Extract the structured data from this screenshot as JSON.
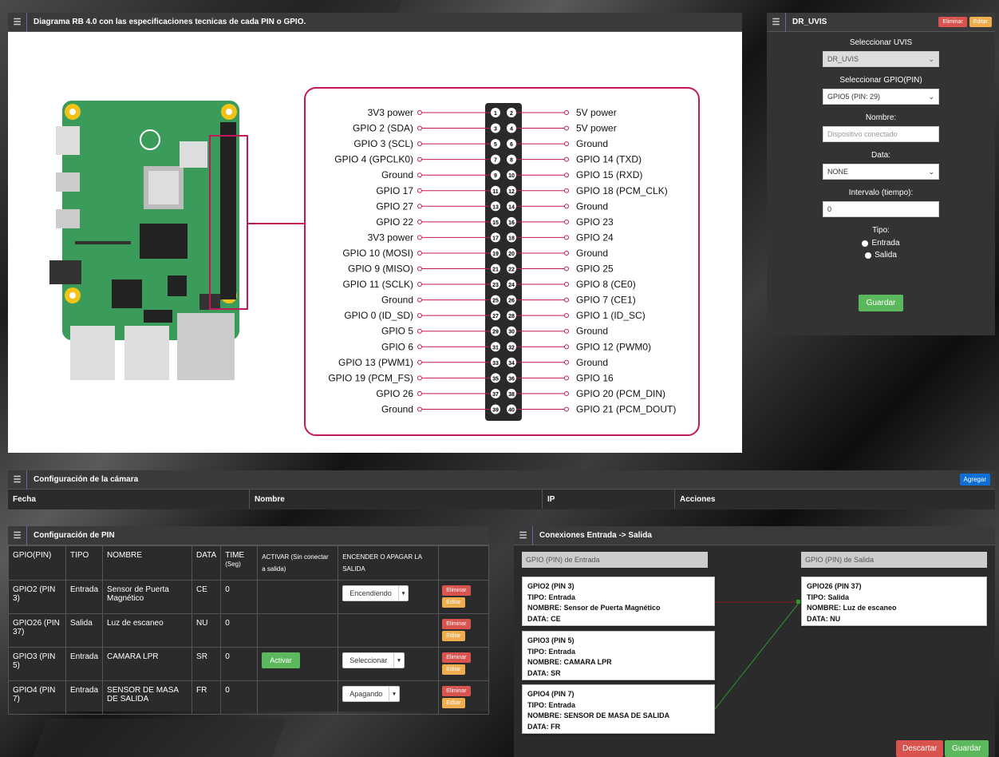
{
  "diagram": {
    "title": "Diagrama RB 4.0 con las especificaciones tecnicas de cada PIN o GPIO.",
    "pins_left": [
      "3V3 power",
      "GPIO 2 (SDA)",
      "GPIO 3 (SCL)",
      "GPIO 4 (GPCLK0)",
      "Ground",
      "GPIO 17",
      "GPIO 27",
      "GPIO 22",
      "3V3 power",
      "GPIO 10 (MOSI)",
      "GPIO 9 (MISO)",
      "GPIO 11 (SCLK)",
      "Ground",
      "GPIO 0 (ID_SD)",
      "GPIO 5",
      "GPIO 6",
      "GPIO 13 (PWM1)",
      "GPIO 19 (PCM_FS)",
      "GPIO 26",
      "Ground"
    ],
    "pins_right": [
      "5V power",
      "5V power",
      "Ground",
      "GPIO 14 (TXD)",
      "GPIO 15 (RXD)",
      "GPIO 18 (PCM_CLK)",
      "Ground",
      "GPIO 23",
      "GPIO 24",
      "Ground",
      "GPIO 25",
      "GPIO 8 (CE0)",
      "GPIO 7 (CE1)",
      "GPIO 1 (ID_SC)",
      "Ground",
      "GPIO 12 (PWM0)",
      "Ground",
      "GPIO 16",
      "GPIO 20 (PCM_DIN)",
      "GPIO 21 (PCM_DOUT)"
    ],
    "accent": "#c2185b"
  },
  "uvis": {
    "title": "DR_UVIS",
    "delete": "Eliminar",
    "edit": "Editar",
    "sel_uvis_label": "Seleccionar UVIS",
    "sel_uvis_value": "DR_UVIS",
    "sel_gpio_label": "Seleccionar GPIO(PIN)",
    "sel_gpio_value": "GPIO5 (PIN: 29)",
    "name_label": "Nombre:",
    "name_placeholder": "Dispositivo conectado",
    "data_label": "Data:",
    "data_value": "NONE",
    "interval_label": "Intervalo (tiempo):",
    "interval_value": "0",
    "type_label": "Tipo:",
    "type_in": "Entrada",
    "type_out": "Salida",
    "save": "Guardar"
  },
  "camera": {
    "title": "Configuración de la cámara",
    "add": "Agregar",
    "cols": [
      "Fecha",
      "Nombre",
      "IP",
      "Acciones"
    ]
  },
  "pins": {
    "title": "Configuración de PIN",
    "cols": [
      "GPIO(PIN)",
      "TIPO",
      "NOMBRE",
      "DATA",
      "TIME",
      "(Seg)",
      "ACTIVAR (Sin conectar",
      "a salida)",
      "ENCENDER O APAGAR LA",
      "SALIDA"
    ],
    "rows": [
      {
        "gpio": "GPIO2 (PIN 3)",
        "tipo": "Entrada",
        "nombre": "Sensor de Puerta Magnético",
        "data": "CE",
        "time": "0",
        "activar": "",
        "dd": "Encendiendo"
      },
      {
        "gpio": "GPIO26 (PIN 37)",
        "tipo": "Salida",
        "nombre": "Luz de escaneo",
        "data": "NU",
        "time": "0",
        "activar": "",
        "dd": ""
      },
      {
        "gpio": "GPIO3 (PIN 5)",
        "tipo": "Entrada",
        "nombre": "CAMARA LPR",
        "data": "SR",
        "time": "0",
        "activar": "Activar",
        "dd": "Seleccionar"
      },
      {
        "gpio": "GPIO4 (PIN 7)",
        "tipo": "Entrada",
        "nombre": "SENSOR DE MASA DE SALIDA",
        "data": "FR",
        "time": "0",
        "activar": "",
        "dd": "Apagando"
      }
    ],
    "delete": "Eliminar",
    "edit": "Editar"
  },
  "conns": {
    "title": "Conexiones Entrada -> Salida",
    "in_head": "GPIO (PIN) de Entrada",
    "out_head": "GPIO (PIN) de Salida",
    "inputs": [
      [
        "GPIO2 (PIN 3)",
        "TIPO: Entrada",
        "NOMBRE: Sensor de Puerta Magnético",
        "DATA: CE"
      ],
      [
        "GPIO3 (PIN 5)",
        "TIPO: Entrada",
        "NOMBRE: CAMARA LPR",
        "DATA: SR"
      ],
      [
        "GPIO4 (PIN 7)",
        "TIPO: Entrada",
        "NOMBRE: SENSOR DE MASA DE SALIDA",
        "DATA: FR"
      ]
    ],
    "output": [
      "GPIO26 (PIN 37)",
      "TIPO: Salida",
      "NOMBRE: Luz de escaneo",
      "DATA: NU"
    ],
    "discard": "Descartar",
    "save": "Guardar"
  }
}
